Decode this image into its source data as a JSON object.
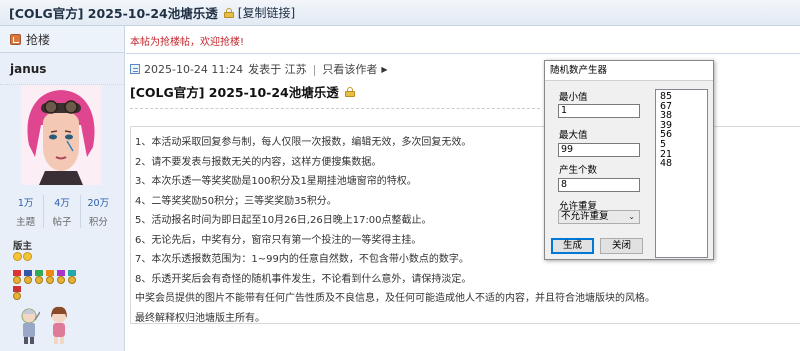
{
  "title_bar": {
    "title": "[COLG官方] 2025-10-24池塘乐透",
    "copy_link": "[复制链接]"
  },
  "sidebar": {
    "grab_label": "抢楼",
    "username": "janus",
    "stats": [
      {
        "value": "1万",
        "label": "主题"
      },
      {
        "value": "4万",
        "label": "帖子"
      },
      {
        "value": "20万",
        "label": "积分"
      }
    ],
    "rank": "版主"
  },
  "content": {
    "notice": "本帖为抢楼帖，欢迎抢楼!",
    "meta": {
      "datetime": "2025-10-24 11:24",
      "posted_from": "发表于 江苏",
      "author_only": "只看该作者"
    },
    "post_title": "[COLG官方] 2025-10-24池塘乐透",
    "rules": [
      "1、本活动采取回复参与制，每人仅限一次报数，编辑无效，多次回复无效。",
      "2、请不要发表与报数无关的内容，这样方便搜集数据。",
      "3、本次乐透一等奖奖励是100积分及1星期挂池塘窗帘的特权。",
      "4、二等奖奖励50积分；三等奖奖励35积分。",
      "5、活动报名时间为即日起至10月26日,26日晚上17:00点整截止。",
      "6、无论先后，中奖有分，窗帘只有第一个投注的一等奖得主挂。",
      "7、本次乐透报数范围为：1~99内的任意自然数，不包含带小数点的数字。",
      "8、乐透开奖后会有奇怪的随机事件发生，不论看到什么意外，请保持淡定。",
      "中奖会员提供的图片不能带有任何广告性质及不良信息，及任何可能造成他人不适的内容，并且符合池塘版块的风格。",
      "最终解释权归池塘版主所有。"
    ]
  },
  "dialog": {
    "title": "随机数产生器",
    "min_label": "最小值",
    "min_value": "1",
    "max_label": "最大值",
    "max_value": "99",
    "count_label": "产生个数",
    "count_value": "8",
    "repeat_label": "允许重复",
    "repeat_value": "不允许重复",
    "output": [
      "85",
      "67",
      "38",
      "39",
      "56",
      "5",
      "21",
      "48"
    ],
    "generate_label": "生成",
    "close_label": "关闭"
  },
  "colors": {
    "notice_red": "#c1272d",
    "link_blue": "#2a5caa",
    "sidebar_bg": "#e8eff8",
    "button_focus": "#0078d7"
  }
}
